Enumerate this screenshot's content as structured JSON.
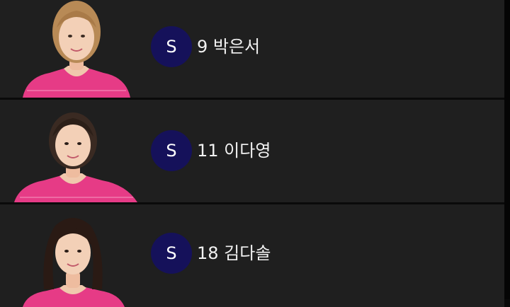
{
  "roster": {
    "players": [
      {
        "position": "S",
        "number": "9",
        "name": "박은서",
        "label": "9 박은서",
        "photo": "player-photo"
      },
      {
        "position": "S",
        "number": "11",
        "name": "이다영",
        "label": "11 이다영",
        "photo": "player-photo"
      },
      {
        "position": "S",
        "number": "18",
        "name": "김다솔",
        "label": "18 김다솔",
        "photo": "player-photo"
      }
    ]
  },
  "colors": {
    "row_background": "#1f1f1f",
    "separator": "#0a0a0a",
    "badge_background": "#15115a",
    "badge_text": "#ffffff",
    "name_text": "#f2f2f2",
    "jersey_pink": "#e63b86"
  }
}
